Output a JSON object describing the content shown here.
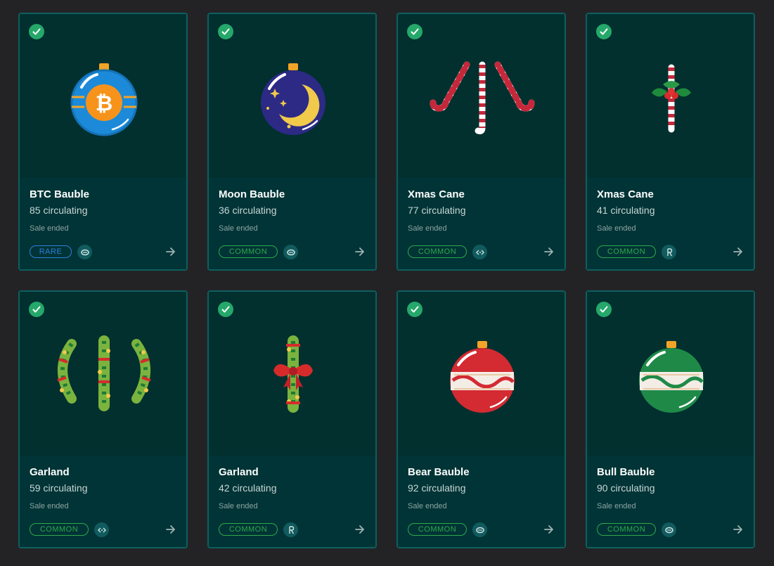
{
  "cards": [
    {
      "title": "BTC Bauble",
      "circulating": "85 circulating",
      "status": "Sale ended",
      "rarity": "RARE",
      "chain_icon": "chain-icon-a",
      "art": "btc-bauble-icon"
    },
    {
      "title": "Moon Bauble",
      "circulating": "36 circulating",
      "status": "Sale ended",
      "rarity": "COMMON",
      "chain_icon": "chain-icon-a",
      "art": "moon-bauble-icon"
    },
    {
      "title": "Xmas Cane",
      "circulating": "77 circulating",
      "status": "Sale ended",
      "rarity": "COMMON",
      "chain_icon": "chain-icon-b",
      "art": "xmas-cane-triple-icon"
    },
    {
      "title": "Xmas Cane",
      "circulating": "41 circulating",
      "status": "Sale ended",
      "rarity": "COMMON",
      "chain_icon": "chain-icon-r",
      "art": "xmas-cane-holly-icon"
    },
    {
      "title": "Garland",
      "circulating": "59 circulating",
      "status": "Sale ended",
      "rarity": "COMMON",
      "chain_icon": "chain-icon-b",
      "art": "garland-triple-icon"
    },
    {
      "title": "Garland",
      "circulating": "42 circulating",
      "status": "Sale ended",
      "rarity": "COMMON",
      "chain_icon": "chain-icon-r",
      "art": "garland-bow-icon"
    },
    {
      "title": "Bear Bauble",
      "circulating": "92 circulating",
      "status": "Sale ended",
      "rarity": "COMMON",
      "chain_icon": "chain-icon-a",
      "art": "bear-bauble-icon"
    },
    {
      "title": "Bull Bauble",
      "circulating": "90 circulating",
      "status": "Sale ended",
      "rarity": "COMMON",
      "chain_icon": "chain-icon-a",
      "art": "bull-bauble-icon"
    }
  ],
  "colors": {
    "page_bg": "#232326",
    "card_bg": "#01302f",
    "card_border": "#0d5f5f",
    "common": "#2fa84a",
    "rare": "#2e7fe0",
    "check": "#25a86a"
  }
}
